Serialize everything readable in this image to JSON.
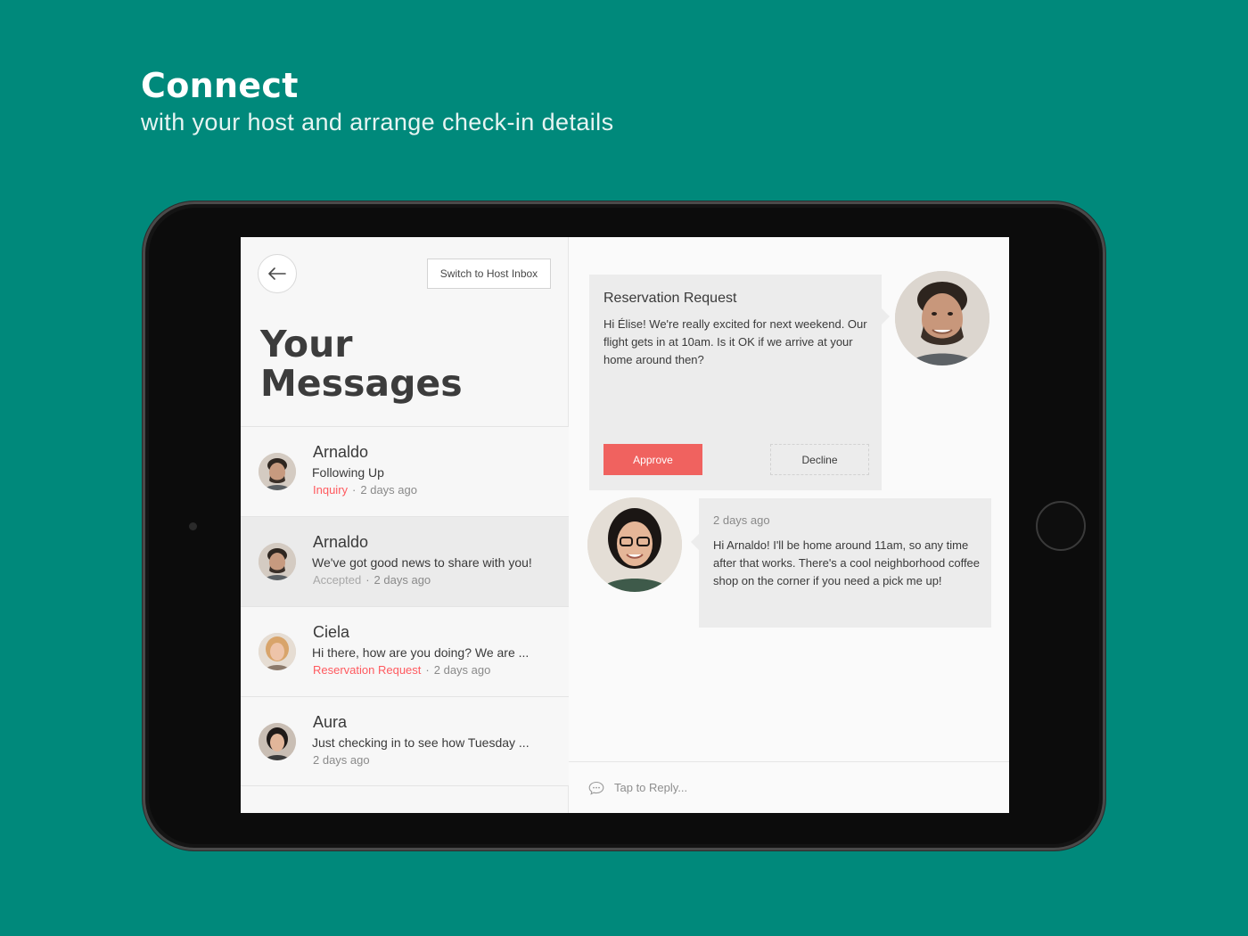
{
  "hero": {
    "title": "Connect",
    "subtitle": "with your host and arrange check-in details"
  },
  "inbox": {
    "back_icon": "arrow-left-icon",
    "switch_label": "Switch to Host Inbox",
    "title_line1": "Your",
    "title_line2": "Messages",
    "threads": [
      {
        "name": "Arnaldo",
        "preview": "Following Up",
        "status": "Inquiry",
        "time": "2 days ago",
        "selected": false
      },
      {
        "name": "Arnaldo",
        "preview": "We've got good news to share with you!",
        "status": "Accepted",
        "time": "2 days ago",
        "selected": true
      },
      {
        "name": "Ciela",
        "preview": "Hi there, how are you doing? We are ...",
        "status": "Reservation Request",
        "time": "2 days ago",
        "selected": false
      },
      {
        "name": "Aura",
        "preview": "Just checking in to see how Tuesday ...",
        "status": "",
        "time": "2 days ago",
        "selected": false
      }
    ]
  },
  "conversation": {
    "request": {
      "title": "Reservation Request",
      "body": "Hi Élise! We're really excited for next weekend. Our flight gets in at 10am. Is it OK if we arrive at your home around then?",
      "approve_label": "Approve",
      "decline_label": "Decline"
    },
    "reply": {
      "time": "2 days ago",
      "body": "Hi Arnaldo! I'll be home around 11am, so any time after that works. There's a cool neighborhood coffee shop on the corner if you need a pick me up!"
    },
    "compose_placeholder": "Tap to Reply...",
    "compose_icon": "chat-bubble-icon"
  },
  "colors": {
    "background": "#00897b",
    "accent": "#ff5a5f",
    "approve": "#f0625f"
  }
}
